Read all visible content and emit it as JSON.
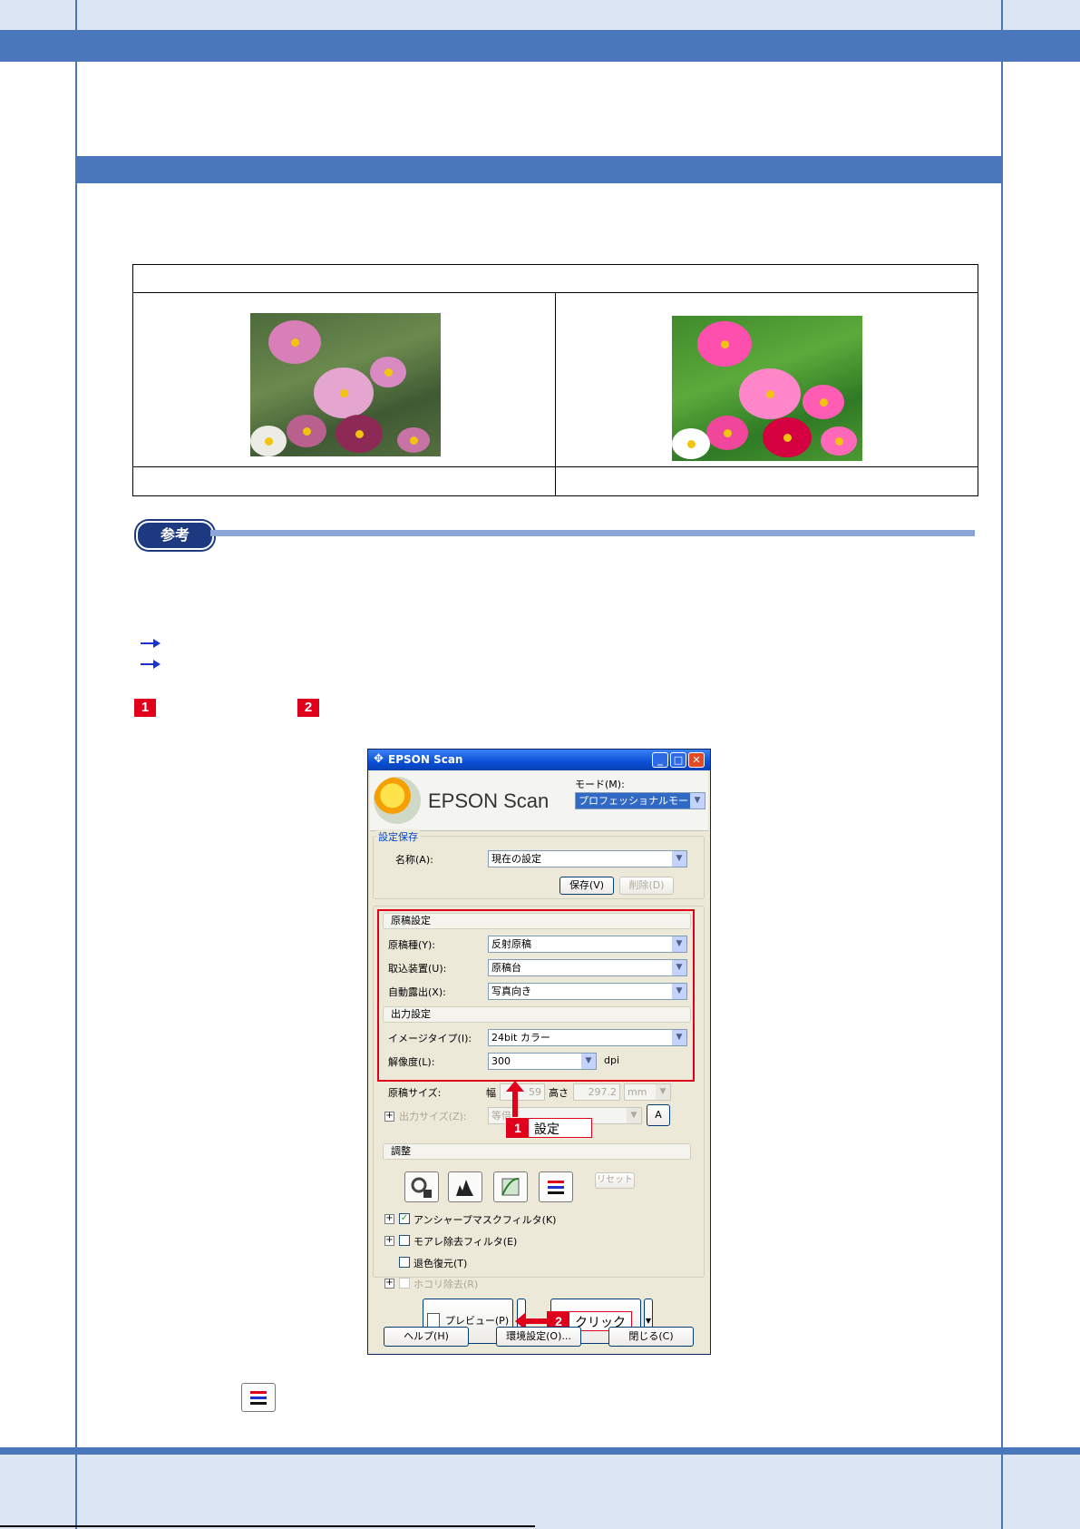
{
  "note": {
    "label": "参考"
  },
  "markers": {
    "step1": "1",
    "step2": "2"
  },
  "dialog": {
    "title": "EPSON Scan",
    "brand": "EPSON Scan",
    "mode_label": "モード(M):",
    "mode_value": "プロフェッショナルモード",
    "save_group_label": "設定保存",
    "name_label": "名称(A):",
    "name_value": "現在の設定",
    "save_button": "保存(V)",
    "delete_button": "削除(D)",
    "doc_settings_header": "原稿設定",
    "doc_type_label": "原稿種(Y):",
    "doc_type_value": "反射原稿",
    "source_label": "取込装置(U):",
    "source_value": "原稿台",
    "exposure_label": "自動露出(X):",
    "exposure_value": "写真向き",
    "output_header": "出力設定",
    "image_type_label": "イメージタイプ(I):",
    "image_type_value": "24bit カラー",
    "resolution_label": "解像度(L):",
    "resolution_value": "300",
    "resolution_unit": "dpi",
    "doc_size_label": "原稿サイズ:",
    "width_label": "幅",
    "width_value": "59",
    "height_label": "高さ",
    "height_value": "297.2",
    "unit_value": "mm",
    "output_size_label": "出力サイズ(Z):",
    "output_size_value": "等倍",
    "adjust_header": "調整",
    "reset_button": "リセット",
    "unsharp_label": "アンシャープマスクフィルタ(K)",
    "moire_label": "モアレ除去フィルタ(E)",
    "fade_label": "退色復元(T)",
    "dust_label": "ホコリ除去(R)",
    "preview_button": "プレビュー(P)",
    "help_button": "ヘルプ(H)",
    "env_button": "環境設定(O)...",
    "close_button": "閉じる(C)",
    "callout1": "設定",
    "callout2": "クリック"
  }
}
